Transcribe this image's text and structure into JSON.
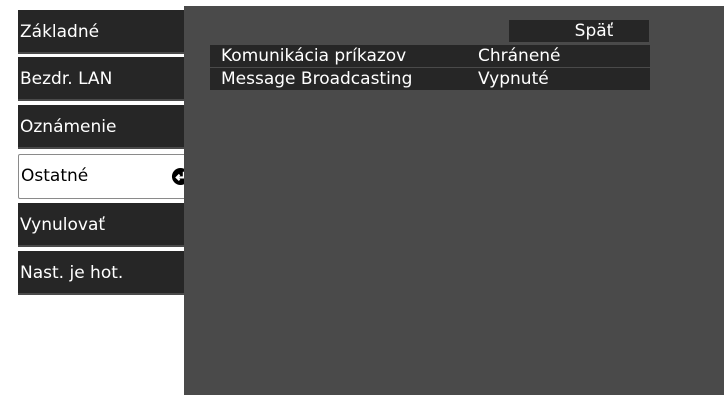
{
  "sidebar": {
    "items": [
      {
        "label": "Základné"
      },
      {
        "label": "Bezdr. LAN"
      },
      {
        "label": "Oznámenie"
      },
      {
        "label": "Ostatné"
      },
      {
        "label": "Vynulovať"
      },
      {
        "label": "Nast. je hot."
      }
    ],
    "selected_index": 3,
    "selected_icon": "enter-icon"
  },
  "panel": {
    "back_label": "Späť",
    "rows": [
      {
        "name": "Komunikácia príkazov",
        "value": "Chránené"
      },
      {
        "name": "Message Broadcasting",
        "value": "Vypnuté"
      }
    ]
  },
  "colors": {
    "menu_bg": "#262626",
    "panel_bg": "#4a4a4a",
    "selected_bg": "#ffffff"
  }
}
